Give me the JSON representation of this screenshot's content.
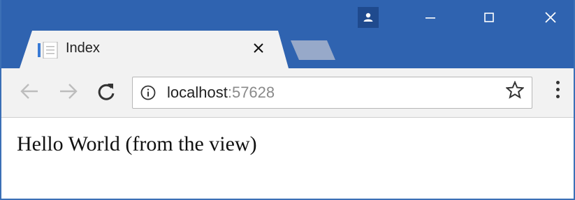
{
  "tab": {
    "title": "Index"
  },
  "address_bar": {
    "host": "localhost",
    "port": ":57628"
  },
  "page": {
    "text": "Hello World (from the view)"
  },
  "icons": {
    "profile": "person-icon",
    "minimize": "minimize-icon",
    "maximize": "maximize-icon",
    "close": "close-icon",
    "back": "arrow-left-icon",
    "forward": "arrow-right-icon",
    "reload": "reload-icon",
    "site_info": "info-icon",
    "bookmark": "star-icon",
    "menu": "kebab-menu-icon"
  },
  "colors": {
    "titlebar": "#2f63b0",
    "tab": "#f2f2f2",
    "toolbar": "#f2f2f2",
    "url_port": "#8a8a8a"
  }
}
